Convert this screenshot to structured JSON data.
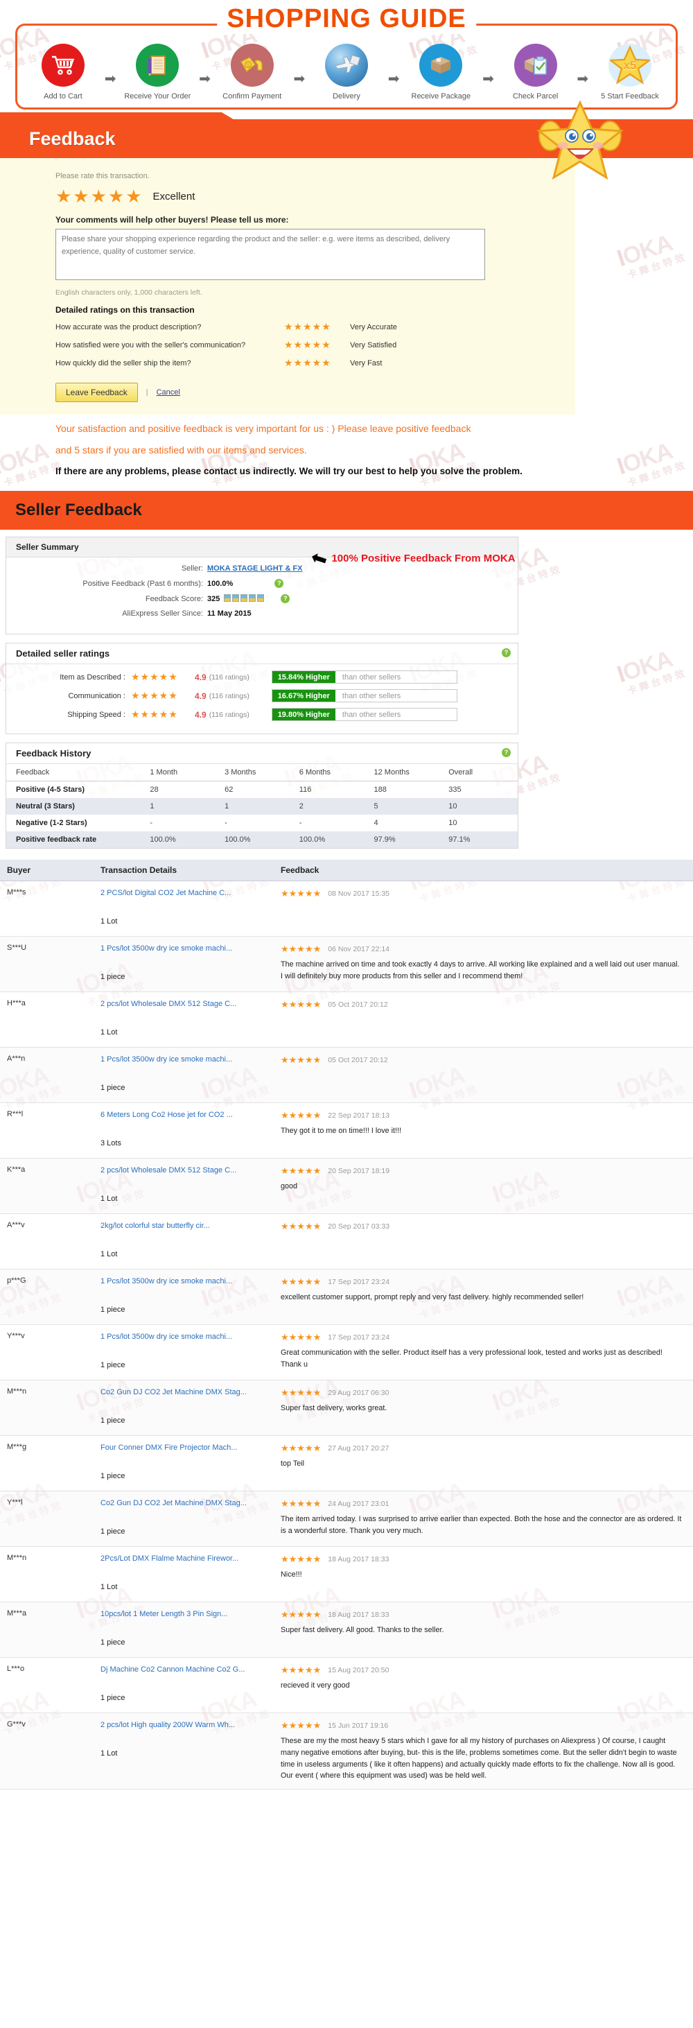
{
  "guide": {
    "title": "SHOPPING GUIDE",
    "steps": [
      {
        "label": "Add to Cart",
        "icon": "shopping-cart-icon",
        "color": "#e41b1b"
      },
      {
        "label": "Receive Your Order",
        "icon": "order-note-icon",
        "color": "#18a04a"
      },
      {
        "label": "Confirm Payment",
        "icon": "money-payment-icon",
        "color": "#c36a6a"
      },
      {
        "label": "Delivery",
        "icon": "airplane-globe-icon",
        "color": "#2f7fb8"
      },
      {
        "label": "Receive Package",
        "icon": "parcel-box-icon",
        "color": "#1f9ad6"
      },
      {
        "label": "Check Parcel",
        "icon": "checklist-parcel-icon",
        "color": "#9b59b6"
      },
      {
        "label": "5 Start Feedback",
        "icon": "five-star-icon",
        "color": "#dbeefb"
      }
    ],
    "star_badge": "x5"
  },
  "feedback": {
    "section_title": "Feedback",
    "rate_prompt": "Please rate this transaction.",
    "rating_stars": "★★★★★",
    "rating_label": "Excellent",
    "comments_label": "Your comments will help other buyers! Please tell us more:",
    "comment_placeholder": "Please share your shopping experience regarding the product and the seller: e.g. were items as described, delivery experience, quality of customer service.",
    "chars_left": "English characters only, 1,000 characters left.",
    "detailed_title": "Detailed ratings on this transaction",
    "detailed": [
      {
        "question": "How accurate was the product description?",
        "stars": "★★★★★",
        "label": "Very Accurate"
      },
      {
        "question": "How satisfied were you with the seller's communication?",
        "stars": "★★★★★",
        "label": "Very Satisfied"
      },
      {
        "question": "How quickly did the seller ship the item?",
        "stars": "★★★★★",
        "label": "Very Fast"
      }
    ],
    "leave_button": "Leave Feedback",
    "separator": "|",
    "cancel_link": "Cancel",
    "promo_line1": "Your satisfaction and positive feedback is very important for us : ) Please leave positive feedback",
    "promo_line2": "and 5 stars if you are satisfied with our items and services.",
    "promo_line3": "If there are any problems, please contact us indirectly. We will try our best to help you solve the problem."
  },
  "seller_feedback": {
    "section_title": "Seller Feedback",
    "summary_title": "Seller Summary",
    "rows": [
      {
        "key": "Seller:",
        "value": "MOKA STAGE LIGHT & FX",
        "link": true,
        "help": false
      },
      {
        "key": "Positive Feedback (Past 6 months):",
        "value": "100.0%",
        "link": false,
        "help": true
      },
      {
        "key": "Feedback Score:",
        "value": "325",
        "link": false,
        "help": true,
        "medals": 5
      },
      {
        "key": "AliExpress Seller Since:",
        "value": "11 May 2015",
        "link": false,
        "help": false
      }
    ],
    "callout": "100% Positive Feedback From MOKA",
    "help_glyph": "?"
  },
  "detailed_seller_ratings": {
    "title": "Detailed seller ratings",
    "rows": [
      {
        "label": "Item as Described :",
        "stars": "★★★★★",
        "score": "4.9",
        "count": "(116 ratings)",
        "compare": "15.84% Higher",
        "compare_rest": "than other sellers"
      },
      {
        "label": "Communication :",
        "stars": "★★★★★",
        "score": "4.9",
        "count": "(116 ratings)",
        "compare": "16.67% Higher",
        "compare_rest": "than other sellers"
      },
      {
        "label": "Shipping Speed :",
        "stars": "★★★★★",
        "score": "4.9",
        "count": "(116 ratings)",
        "compare": "19.80% Higher",
        "compare_rest": "than other sellers"
      }
    ]
  },
  "feedback_history": {
    "title": "Feedback History",
    "columns": [
      "Feedback",
      "1 Month",
      "3 Months",
      "6 Months",
      "12 Months",
      "Overall"
    ],
    "rows": [
      {
        "label": "Positive (4-5 Stars)",
        "values": [
          "28",
          "62",
          "116",
          "188",
          "335"
        ]
      },
      {
        "label": "Neutral (3 Stars)",
        "values": [
          "1",
          "1",
          "2",
          "5",
          "10"
        ]
      },
      {
        "label": "Negative (1-2 Stars)",
        "values": [
          "-",
          "-",
          "-",
          "4",
          "10"
        ]
      },
      {
        "label": "Positive feedback rate",
        "values": [
          "100.0%",
          "100.0%",
          "100.0%",
          "97.9%",
          "97.1%"
        ]
      }
    ]
  },
  "buyer_feedback": {
    "columns": [
      "Buyer",
      "Transaction Details",
      "Feedback"
    ],
    "rows": [
      {
        "buyer": "M***s",
        "product": "2 PCS/lot Digital CO2 Jet Machine C...",
        "qty": "1 Lot",
        "stars": "★★★★★",
        "date": "08 Nov 2017 15:35",
        "text": ""
      },
      {
        "buyer": "S***U",
        "product": "1 Pcs/lot 3500w dry ice smoke machi...",
        "qty": "1 piece",
        "stars": "★★★★★",
        "date": "06 Nov 2017 22:14",
        "text": "The machine arrived on time and took exactly 4 days to arrive. All working like explained and a well laid out user manual. I will definitely buy more products from this seller and I recommend them!"
      },
      {
        "buyer": "H***a",
        "product": "2 pcs/lot Wholesale DMX 512 Stage C...",
        "qty": "1 Lot",
        "stars": "★★★★★",
        "date": "05 Oct 2017 20:12",
        "text": ""
      },
      {
        "buyer": "A***n",
        "product": "1 Pcs/lot 3500w dry ice smoke machi...",
        "qty": "1 piece",
        "stars": "★★★★★",
        "date": "05 Oct 2017 20:12",
        "text": ""
      },
      {
        "buyer": "R***l",
        "product": "6 Meters Long Co2 Hose jet for CO2 ...",
        "qty": "3 Lots",
        "stars": "★★★★★",
        "date": "22 Sep 2017 18:13",
        "text": "They got it to me on time!!! I love it!!!"
      },
      {
        "buyer": "K***a",
        "product": "2 pcs/lot Wholesale DMX 512 Stage C...",
        "qty": "1 Lot",
        "stars": "★★★★★",
        "date": "20 Sep 2017 18:19",
        "text": "good"
      },
      {
        "buyer": "A***v",
        "product": "2kg/lot colorful star butterfly cir...",
        "qty": "1 Lot",
        "stars": "★★★★★",
        "date": "20 Sep 2017 03:33",
        "text": ""
      },
      {
        "buyer": "p***G",
        "product": "1 Pcs/lot 3500w dry ice smoke machi...",
        "qty": "1 piece",
        "stars": "★★★★★",
        "date": "17 Sep 2017 23:24",
        "text": "excellent customer support, prompt reply and very fast delivery. highly recommended seller!"
      },
      {
        "buyer": "Y***v",
        "product": "1 Pcs/lot 3500w dry ice smoke machi...",
        "qty": "1 piece",
        "stars": "★★★★★",
        "date": "17 Sep 2017 23:24",
        "text": "Great communication with the seller. Product itself has a very professional look, tested and works just as described! Thank u"
      },
      {
        "buyer": "M***n",
        "product": "Co2 Gun DJ CO2 Jet Machine DMX Stag...",
        "qty": "1 piece",
        "stars": "★★★★★",
        "date": "29 Aug 2017 06:30",
        "text": "Super fast delivery, works great."
      },
      {
        "buyer": "M***g",
        "product": "Four Conner DMX Fire Projector Mach...",
        "qty": "1 piece",
        "stars": "★★★★★",
        "date": "27 Aug 2017 20:27",
        "text": "top Teil"
      },
      {
        "buyer": "Y***l",
        "product": "Co2 Gun DJ CO2 Jet Machine DMX Stag...",
        "qty": "1 piece",
        "stars": "★★★★★",
        "date": "24 Aug 2017 23:01",
        "text": "The item arrived today. I was surprised to arrive earlier than expected. Both the hose and the connector are as ordered. It is a wonderful store. Thank you very much."
      },
      {
        "buyer": "M***n",
        "product": "2Pcs/Lot DMX Flalme Machine Firewor...",
        "qty": "1 Lot",
        "stars": "★★★★★",
        "date": "18 Aug 2017 18:33",
        "text": "Nice!!!"
      },
      {
        "buyer": "M***a",
        "product": "10pcs/lot 1 Meter Length 3 Pin Sign...",
        "qty": "1 piece",
        "stars": "★★★★★",
        "date": "18 Aug 2017 18:33",
        "text": "Super fast delivery. All good. Thanks to the seller."
      },
      {
        "buyer": "L***o",
        "product": "Dj Machine Co2 Cannon Machine Co2 G...",
        "qty": "1 piece",
        "stars": "★★★★★",
        "date": "15 Aug 2017 20:50",
        "text": "recieved it very good"
      },
      {
        "buyer": "G***v",
        "product": "2 pcs/lot High quality 200W Warm Wh...",
        "qty": "1 Lot",
        "stars": "★★★★★",
        "date": "15 Jun 2017 19:16",
        "text": "These are my the most heavy 5 stars which I gave for all my history of purchases on Aliexpress ) Of course, I caught many negative emotions after buying, but- this is the life, problems sometimes come. But the seller didn't begin to waste time in useless arguments ( like it often happens) and actually quickly made efforts to fix the challenge. Now all is good. Our event ( where this equipment was used) was be held well."
      }
    ]
  },
  "watermark": {
    "text": "IOKA",
    "sub": "卡舞台特效"
  }
}
